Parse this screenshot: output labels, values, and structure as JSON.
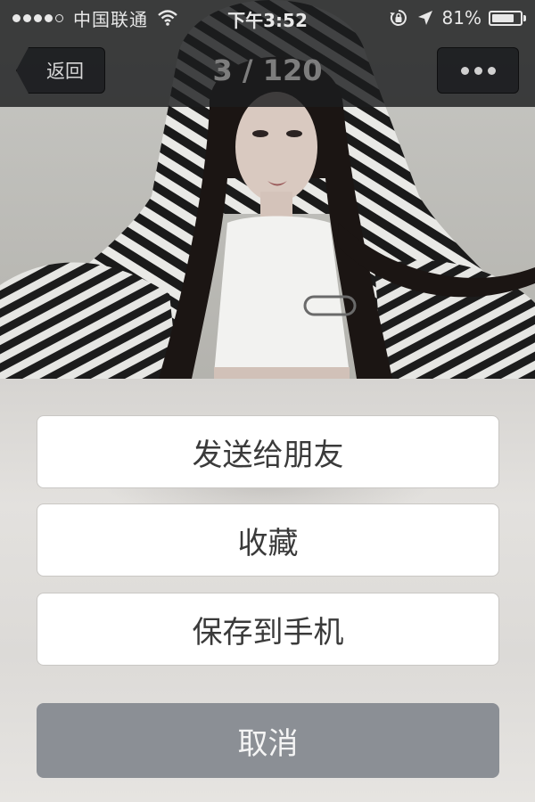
{
  "status_bar": {
    "carrier": "中国联通",
    "time": "下午3:52",
    "battery_percent": "81%",
    "battery_level": 0.81,
    "signal_bars_filled": 4,
    "signal_bars_total": 5,
    "icons": [
      "wifi-icon",
      "rotation-lock-icon",
      "location-arrow-icon",
      "battery-icon"
    ]
  },
  "nav": {
    "back_label": "返回",
    "title": "3 / 120",
    "more_icon": "ellipsis-icon"
  },
  "photo": {
    "subject": "woman-in-striped-hood-photo"
  },
  "action_sheet": {
    "send_to_friend": "发送给朋友",
    "favorite": "收藏",
    "save_to_phone": "保存到手机",
    "cancel": "取消"
  },
  "colors": {
    "bar_background": "#1c1d1f",
    "sheet_button": "#ffffff",
    "cancel_button": "#8b8f95",
    "sheet_text": "#3a3a3a"
  }
}
